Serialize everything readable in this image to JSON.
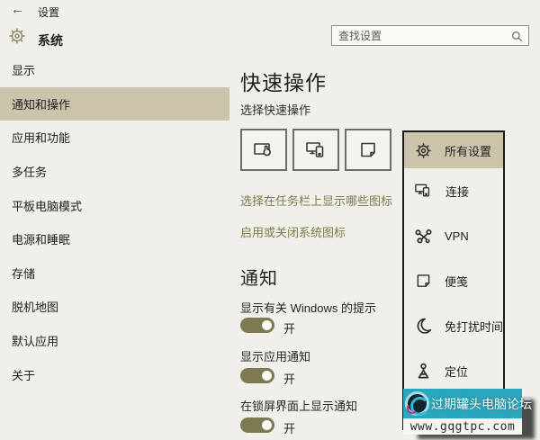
{
  "titlebar": {
    "back_label": "←",
    "app_title": "设置"
  },
  "nav_header": {
    "section_title": "系统"
  },
  "search": {
    "placeholder": "查找设置"
  },
  "sidebar": {
    "items": [
      {
        "label": "显示",
        "selected": false
      },
      {
        "label": "通知和操作",
        "selected": true
      },
      {
        "label": "应用和功能",
        "selected": false
      },
      {
        "label": "多任务",
        "selected": false
      },
      {
        "label": "平板电脑模式",
        "selected": false
      },
      {
        "label": "电源和睡眠",
        "selected": false
      },
      {
        "label": "存储",
        "selected": false
      },
      {
        "label": "脱机地图",
        "selected": false
      },
      {
        "label": "默认应用",
        "selected": false
      },
      {
        "label": "关于",
        "selected": false
      }
    ]
  },
  "main": {
    "quick_actions_title": "快速操作",
    "quick_actions_subtitle": "选择快速操作",
    "tiles": [
      {
        "icon": "tablet-mode-icon"
      },
      {
        "icon": "connect-icon"
      },
      {
        "icon": "sticky-note-icon"
      }
    ],
    "links": [
      {
        "label": "选择在任务栏上显示哪些图标"
      },
      {
        "label": "启用或关闭系统图标"
      }
    ],
    "notifications_title": "通知",
    "toggles": [
      {
        "label": "显示有关 Windows 的提示",
        "state": "开",
        "on": true
      },
      {
        "label": "显示应用通知",
        "state": "开",
        "on": true
      },
      {
        "label": "在锁屏界面上显示通知",
        "state": "开",
        "on": true
      }
    ]
  },
  "flyout": {
    "items": [
      {
        "label": "所有设置",
        "icon": "gear-icon",
        "highlighted": true
      },
      {
        "label": "连接",
        "icon": "connect-icon",
        "highlighted": false
      },
      {
        "label": "VPN",
        "icon": "vpn-icon",
        "highlighted": false
      },
      {
        "label": "便笺",
        "icon": "sticky-note-icon",
        "highlighted": false
      },
      {
        "label": "免打扰时间",
        "icon": "moon-icon",
        "highlighted": false
      },
      {
        "label": "定位",
        "icon": "location-icon",
        "highlighted": false
      }
    ]
  },
  "watermark": {
    "site_name": "过期罐头电脑论坛",
    "site_url": "www.gqgtpc.com"
  },
  "colors": {
    "accent_tan": "#cbc4ab",
    "toggle_olive": "#7d7950",
    "link_olive": "#7e7a4b",
    "panel_border": "#1c1c1c",
    "watermark_teal": "#2aa7bc"
  }
}
